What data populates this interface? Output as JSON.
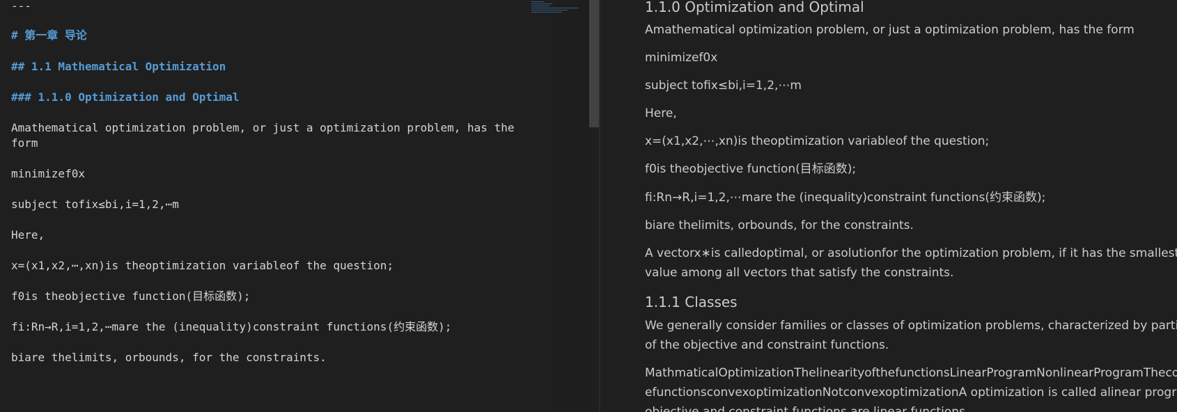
{
  "editor": {
    "lines": [
      "---",
      "# 第一章 导论",
      "## 1.1 Mathematical Optimization",
      "### 1.1.0 Optimization and Optimal",
      "Amathematical optimization problem, or just a optimization problem, has the",
      "form",
      "minimizef0x",
      "subject tofix≤bi,i=1,2,⋯m",
      "Here,",
      "x=(x1,x2,⋯,xn)is theoptimization variableof the question;",
      "f0is theobjective function(目标函数);",
      "fi:Rn→R,i=1,2,⋯mare the (inequality)constraint functions(约束函数);",
      "biare thelimits, orbounds, for the constraints."
    ]
  },
  "preview": {
    "heading_110": "1.1.0 Optimization and Optimal",
    "p_problem": "Amathematical optimization problem, or just a optimization problem, has the form",
    "p_minimize": "minimizef0x",
    "p_subject": "subject tofix≤bi,i=1,2,⋯m",
    "p_here": "Here,",
    "p_x": "x=(x1,x2,⋯,xn)is theoptimization variableof the question;",
    "p_f0": "f0is theobjective function(目标函数);",
    "p_fi": "fi:Rn→R,i=1,2,⋯mare the (inequality)constraint functions(约束函数);",
    "p_bi": "biare thelimits, orbounds, for the constraints.",
    "p_vector_1": "A vectorx∗is calledoptimal, or asolutionfor the optimization problem, if it has the smallest objective",
    "p_vector_2": "value among all vectors that satisfy the constraints.",
    "heading_111": "1.1.1 Classes",
    "p_classes_1": "We generally consider families or classes of optimization problems, characterized by particular forms",
    "p_classes_2": "of the objective and constraint functions.",
    "p_math_1": "MathmaticalOptimizationThelinearityofthefunctionsLinearProgramNonlinearProgramTheconvexityofth",
    "p_math_2": "efunctionsconvexoptimizationNotconvexoptimizationA optimization is called alinear program, if the",
    "p_math_3": "objective and constraint functions are linear functions"
  },
  "colors": {
    "editor_bg": "#1f1f1f",
    "heading_blue": "#569cd6",
    "code_text": "#d4d4d4",
    "preview_text": "#cccccc",
    "scroll_thumb": "#424242"
  }
}
